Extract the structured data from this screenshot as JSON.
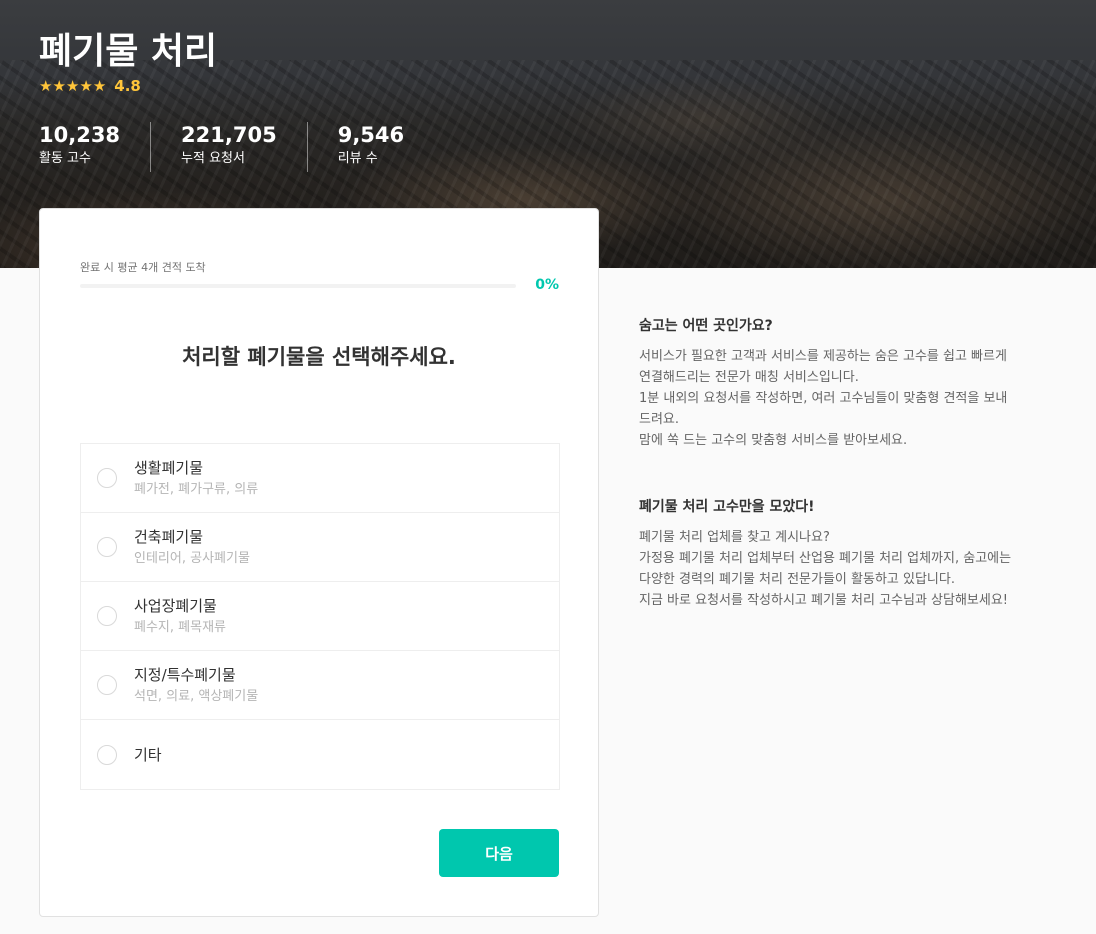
{
  "hero": {
    "title": "폐기물 처리",
    "rating": "4.8",
    "star_count": 5,
    "stats": [
      {
        "value": "10,238",
        "label": "활동 고수"
      },
      {
        "value": "221,705",
        "label": "누적 요청서"
      },
      {
        "value": "9,546",
        "label": "리뷰 수"
      }
    ]
  },
  "form": {
    "progress_caption": "완료 시 평균 4개 견적 도착",
    "progress_percent_label": "0%",
    "progress_fraction": 0,
    "question": "처리할 폐기물을 선택해주세요.",
    "options": [
      {
        "label": "생활폐기물",
        "sub": "폐가전, 폐가구류, 의류"
      },
      {
        "label": "건축폐기물",
        "sub": "인테리어, 공사폐기물"
      },
      {
        "label": "사업장폐기물",
        "sub": "폐수지, 폐목재류"
      },
      {
        "label": "지정/특수폐기물",
        "sub": "석면, 의료, 액상폐기물"
      },
      {
        "label": "기타",
        "sub": ""
      }
    ],
    "next_label": "다음"
  },
  "info": {
    "about_title": "숨고는 어떤 곳인가요?",
    "about_body": "서비스가 필요한 고객과 서비스를 제공하는 숨은 고수를 쉽고 빠르게 연결해드리는 전문가 매칭 서비스입니다.\n1분 내외의 요청서를 작성하면, 여러 고수님들이 맞춤형 견적을 보내드려요.\n맘에 쏙 드는 고수의 맞춤형 서비스를 받아보세요.",
    "pros_title": "폐기물 처리 고수만을 모았다!",
    "pros_body": "폐기물 처리 업체를 찾고 계시나요?\n가정용 폐기물 처리 업체부터 산업용 폐기물 처리 업체까지, 숨고에는 다양한 경력의 폐기물 처리 전문가들이 활동하고 있답니다.\n지금 바로 요청서를 작성하시고 폐기물 처리 고수님과 상담해보세요!"
  },
  "colors": {
    "accent": "#00c7ae",
    "star": "#ffc53a"
  },
  "icons": {
    "star": "star-icon",
    "radio": "radio-unchecked-icon"
  }
}
